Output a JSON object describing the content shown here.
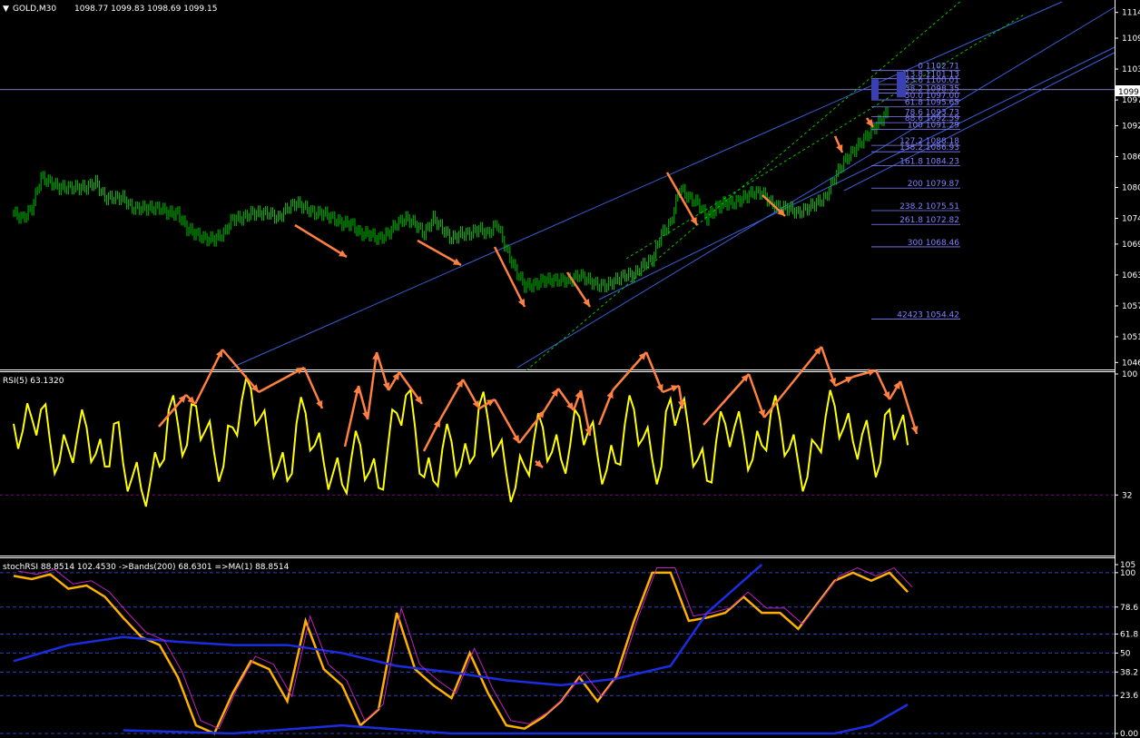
{
  "header": {
    "symbol": "GOLD,M30",
    "ohlc": "1098.77 1099.83 1098.69 1099.15"
  },
  "price_marker": "1099",
  "colors": {
    "background": "#000000",
    "candles": "#00c000",
    "channel_lines": "#3a5fd9",
    "dotted_lines": "#00c000",
    "arrows": "#ff8040",
    "rsi_line": "#ffff00",
    "stoch_line": "#ffb000",
    "bands_line": "#1a2de0",
    "ma_line": "#c020c0",
    "fib_text": "#8080ff",
    "level_line": "#800080"
  },
  "chart_data": [
    {
      "type": "candlestick",
      "panel": "price",
      "title": "GOLD,M30",
      "ylim": [
        1045,
        1115
      ],
      "y_ticks": [
        "1114",
        "1109",
        "1103",
        "1097",
        "1092",
        "1086",
        "1080",
        "1074",
        "1069",
        "1063",
        "1057",
        "1051",
        "1046"
      ],
      "current_price": 1099,
      "series": [
        {
          "name": "close",
          "x": [
            0,
            10,
            20,
            30,
            40,
            50,
            60,
            70,
            80,
            90,
            100,
            110,
            120,
            130,
            140,
            150,
            160,
            170,
            180,
            190,
            200,
            210,
            220,
            230,
            240,
            250,
            260,
            270,
            280,
            290,
            300,
            310,
            320,
            330,
            340,
            350,
            360,
            370,
            380,
            390,
            400,
            410,
            420,
            430,
            440,
            450,
            460,
            470,
            480,
            490,
            500,
            510,
            520,
            530,
            540,
            550,
            560,
            570,
            580,
            590,
            600,
            610,
            620,
            630,
            640,
            650,
            660,
            670,
            680,
            690,
            700,
            710,
            720,
            730,
            740,
            750,
            760,
            770,
            780,
            790,
            800,
            810,
            820,
            830,
            840,
            850,
            860,
            870,
            880,
            890,
            900,
            910,
            920,
            930,
            940,
            950,
            960
          ],
          "values": [
            1075,
            1074,
            1076,
            1082,
            1081,
            1080,
            1080,
            1080,
            1080,
            1081,
            1078,
            1078,
            1078,
            1076,
            1076,
            1076,
            1076,
            1075,
            1075,
            1072,
            1071,
            1070,
            1070,
            1071,
            1074,
            1074,
            1075,
            1075,
            1075,
            1074,
            1076,
            1077,
            1076,
            1075,
            1075,
            1074,
            1073,
            1073,
            1071,
            1071,
            1070,
            1071,
            1073,
            1074,
            1073,
            1071,
            1074,
            1072,
            1070,
            1071,
            1071,
            1072,
            1071,
            1073,
            1068,
            1064,
            1061,
            1061,
            1062,
            1062,
            1062,
            1062,
            1063,
            1062,
            1061,
            1061,
            1062,
            1063,
            1063,
            1065,
            1066,
            1071,
            1073,
            1080,
            1078,
            1077,
            1074,
            1076,
            1077,
            1077,
            1078,
            1079,
            1079,
            1077,
            1076,
            1076,
            1075,
            1076,
            1077,
            1078,
            1082,
            1085,
            1087,
            1089,
            1091,
            1093,
            1095
          ]
        }
      ],
      "fibonacci": [
        {
          "level": "0",
          "price": "1102.71"
        },
        {
          "level": "13.8",
          "price": "1101.13"
        },
        {
          "level": "23.6",
          "price": "1100.01"
        },
        {
          "level": "38.2",
          "price": "1098.35"
        },
        {
          "level": "50.0",
          "price": "1097.00"
        },
        {
          "level": "61.8",
          "price": "1095.65"
        },
        {
          "level": "78.6",
          "price": "1093.73"
        },
        {
          "level": "88.6",
          "price": "1092.59"
        },
        {
          "level": "100",
          "price": "1091.29"
        },
        {
          "level": "127.2",
          "price": "1088.18"
        },
        {
          "level": "138.2",
          "price": "1086.93"
        },
        {
          "level": "161.8",
          "price": "1084.23"
        },
        {
          "level": "200",
          "price": "1079.87"
        },
        {
          "level": "238.2",
          "price": "1075.51"
        },
        {
          "level": "261.8",
          "price": "1072.82"
        },
        {
          "level": "300",
          "price": "1068.46"
        },
        {
          "level": "42423",
          "price": "1054.42"
        }
      ]
    },
    {
      "type": "line",
      "panel": "rsi",
      "title": "RSI(5) 63.1320",
      "ylim": [
        0,
        100
      ],
      "y_ticks": [
        "100",
        "32"
      ],
      "levels": [
        32
      ],
      "series": [
        {
          "name": "RSI(5)",
          "x": [
            0,
            10,
            20,
            30,
            40,
            50,
            60,
            70,
            80,
            90,
            100,
            110,
            120,
            130,
            140,
            150,
            160,
            170,
            180,
            190,
            200,
            210,
            220,
            230,
            240,
            250,
            260,
            270,
            280,
            290,
            300,
            310,
            320,
            330,
            340,
            350,
            360,
            370,
            380,
            390,
            400,
            410,
            420,
            430,
            440,
            450,
            460,
            470,
            480,
            490,
            500,
            510,
            520,
            530,
            540,
            550,
            560,
            570,
            580,
            590,
            600,
            610,
            620,
            630,
            640,
            650,
            660,
            670,
            680,
            690,
            700,
            710,
            720,
            730,
            740,
            750,
            760,
            770,
            780,
            790,
            800,
            810,
            820,
            830,
            840,
            850,
            860,
            870,
            880,
            890,
            900,
            910,
            920,
            930,
            940,
            950,
            960,
            970,
            980
          ],
          "values": [
            72,
            68,
            75,
            80,
            62,
            50,
            58,
            66,
            70,
            55,
            48,
            72,
            50,
            42,
            35,
            40,
            48,
            80,
            72,
            60,
            82,
            68,
            55,
            48,
            70,
            85,
            92,
            75,
            60,
            48,
            40,
            72,
            78,
            60,
            50,
            44,
            38,
            52,
            60,
            45,
            36,
            58,
            78,
            88,
            70,
            42,
            40,
            58,
            62,
            48,
            50,
            82,
            74,
            58,
            44,
            36,
            48,
            62,
            70,
            56,
            52,
            60,
            76,
            68,
            54,
            46,
            50,
            72,
            80,
            64,
            52,
            48,
            86,
            80,
            68,
            52,
            40,
            62,
            72,
            70,
            64,
            52,
            60,
            78,
            74,
            58,
            50,
            42,
            60,
            76,
            82,
            70,
            62,
            66,
            58,
            50,
            80,
            70,
            60
          ]
        }
      ]
    },
    {
      "type": "line",
      "panel": "stochastic",
      "title": "stochRSI 88.8514 102.4530 ->Bands(200) 68.6301 =>MA(1) 88.8514",
      "ylim": [
        0,
        105
      ],
      "y_ticks": [
        "105",
        "100",
        "78.6",
        "61.8",
        "50",
        "38.2",
        "23.6",
        "0.00"
      ],
      "levels": [
        100,
        78.6,
        61.8,
        50,
        38.2,
        23.6,
        0
      ],
      "series": [
        {
          "name": "stochRSI",
          "x": [
            0,
            20,
            40,
            60,
            80,
            100,
            120,
            140,
            160,
            180,
            200,
            220,
            240,
            260,
            280,
            300,
            320,
            340,
            360,
            380,
            400,
            420,
            440,
            460,
            480,
            500,
            520,
            540,
            560,
            580,
            600,
            620,
            640,
            660,
            680,
            700,
            720,
            740,
            760,
            780,
            800,
            820,
            840,
            860,
            880,
            900,
            920,
            940,
            960,
            980
          ],
          "values": [
            98,
            96,
            99,
            90,
            92,
            85,
            72,
            60,
            55,
            35,
            5,
            0,
            25,
            45,
            40,
            20,
            70,
            40,
            30,
            5,
            15,
            75,
            40,
            30,
            22,
            50,
            25,
            5,
            3,
            10,
            20,
            35,
            20,
            35,
            70,
            100,
            100,
            70,
            72,
            75,
            85,
            75,
            75,
            65,
            80,
            95,
            100,
            95,
            100,
            88
          ]
        },
        {
          "name": "Bands(200)",
          "x": [
            0,
            60,
            120,
            180,
            240,
            300,
            360,
            420,
            480,
            540,
            600,
            660,
            720,
            760,
            800,
            820
          ],
          "values": [
            45,
            55,
            60,
            57,
            55,
            55,
            50,
            42,
            38,
            33,
            30,
            34,
            42,
            75,
            95,
            105
          ]
        },
        {
          "name": "Bands(200) lower",
          "x": [
            120,
            240,
            360,
            480,
            600,
            720,
            840,
            900,
            940,
            980
          ],
          "values": [
            2,
            0,
            5,
            0,
            0,
            0,
            0,
            0,
            5,
            18
          ]
        },
        {
          "name": "Bands(200) mid",
          "x": [
            400,
            520,
            640,
            760,
            860,
            940,
            980
          ],
          "values": [
            88,
            80,
            79,
            78,
            70,
            65,
            68
          ]
        }
      ]
    }
  ]
}
